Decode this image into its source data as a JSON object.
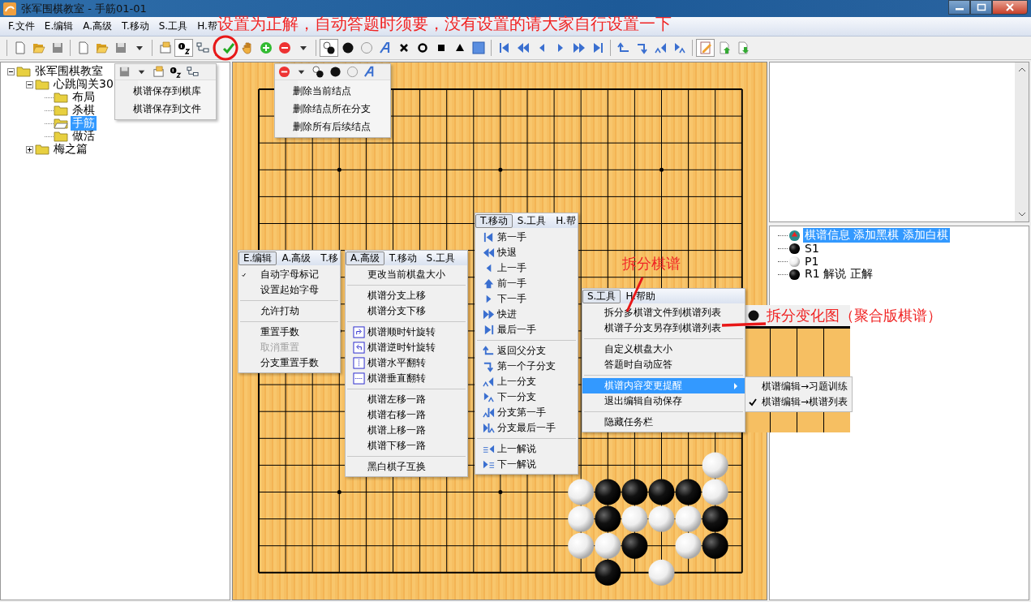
{
  "window": {
    "title": "张军围棋教室 - 手筋01-01"
  },
  "menu_bar": [
    "F.文件",
    "E.编辑",
    "A.高级",
    "T.移动",
    "S.工具",
    "H.帮"
  ],
  "toolbar_toggles": [
    {
      "pressed": true
    },
    {
      "pressed": true
    },
    {
      "pressed": true
    }
  ],
  "file_tree": [
    {
      "label": "张军围棋教室",
      "expanded": true,
      "selected": false,
      "children": [
        {
          "label": "心跳闯关30",
          "expanded": true,
          "selected": false,
          "children": [
            {
              "label": "布局",
              "selected": false
            },
            {
              "label": "杀棋",
              "selected": false
            },
            {
              "label": "手筋",
              "selected": true
            },
            {
              "label": "做活",
              "selected": false
            }
          ]
        },
        {
          "label": "梅之篇",
          "expanded": false,
          "selected": false
        }
      ]
    }
  ],
  "board": {
    "rows": [
      {
        "cells": [
          {
            "kind": "empty"
          },
          {
            "kind": "empty"
          },
          {
            "kind": "empty"
          },
          {
            "kind": "empty"
          },
          {
            "kind": "empty"
          },
          {
            "kind": "empty"
          },
          {
            "kind": "empty"
          },
          {
            "kind": "empty"
          },
          {
            "kind": "empty"
          },
          {
            "kind": "empty"
          },
          {
            "kind": "empty"
          },
          {
            "kind": "empty"
          },
          {
            "kind": "empty"
          },
          {
            "kind": "empty"
          },
          {
            "kind": "empty"
          },
          {
            "kind": "empty"
          },
          {
            "kind": "empty"
          },
          {
            "kind": "empty"
          },
          {
            "kind": "empty"
          }
        ]
      },
      {
        "cells": [
          {
            "kind": "empty"
          },
          {
            "kind": "empty"
          },
          {
            "kind": "empty"
          },
          {
            "kind": "empty"
          },
          {
            "kind": "empty"
          },
          {
            "kind": "empty"
          },
          {
            "kind": "empty"
          },
          {
            "kind": "empty"
          },
          {
            "kind": "empty"
          },
          {
            "kind": "empty"
          },
          {
            "kind": "empty"
          },
          {
            "kind": "empty"
          },
          {
            "kind": "empty"
          },
          {
            "kind": "empty"
          },
          {
            "kind": "empty"
          },
          {
            "kind": "empty"
          },
          {
            "kind": "empty"
          },
          {
            "kind": "empty"
          },
          {
            "kind": "empty"
          }
        ]
      },
      {
        "cells": [
          {
            "kind": "empty"
          },
          {
            "kind": "empty"
          },
          {
            "kind": "empty"
          },
          {
            "kind": "empty"
          },
          {
            "kind": "empty"
          },
          {
            "kind": "empty"
          },
          {
            "kind": "empty"
          },
          {
            "kind": "empty"
          },
          {
            "kind": "empty"
          },
          {
            "kind": "empty"
          },
          {
            "kind": "empty"
          },
          {
            "kind": "empty"
          },
          {
            "kind": "empty"
          },
          {
            "kind": "empty"
          },
          {
            "kind": "empty"
          },
          {
            "kind": "empty"
          },
          {
            "kind": "empty"
          },
          {
            "kind": "empty"
          },
          {
            "kind": "empty"
          }
        ]
      },
      {
        "cells": [
          {
            "kind": "empty"
          },
          {
            "kind": "empty"
          },
          {
            "kind": "empty"
          },
          {
            "kind": "empty"
          },
          {
            "kind": "empty"
          },
          {
            "kind": "empty"
          },
          {
            "kind": "empty"
          },
          {
            "kind": "empty"
          },
          {
            "kind": "empty"
          },
          {
            "kind": "empty"
          },
          {
            "kind": "empty"
          },
          {
            "kind": "empty"
          },
          {
            "kind": "empty"
          },
          {
            "kind": "empty"
          },
          {
            "kind": "empty"
          },
          {
            "kind": "empty"
          },
          {
            "kind": "empty"
          },
          {
            "kind": "empty"
          },
          {
            "kind": "empty"
          }
        ]
      },
      {
        "cells": [
          {
            "kind": "empty"
          },
          {
            "kind": "empty"
          },
          {
            "kind": "empty"
          },
          {
            "kind": "empty"
          },
          {
            "kind": "empty"
          },
          {
            "kind": "empty"
          },
          {
            "kind": "empty"
          },
          {
            "kind": "empty"
          },
          {
            "kind": "empty"
          },
          {
            "kind": "empty"
          },
          {
            "kind": "empty"
          },
          {
            "kind": "empty"
          },
          {
            "kind": "empty"
          },
          {
            "kind": "empty"
          },
          {
            "kind": "empty"
          },
          {
            "kind": "empty"
          },
          {
            "kind": "empty"
          },
          {
            "kind": "empty"
          },
          {
            "kind": "empty"
          }
        ]
      },
      {
        "cells": [
          {
            "kind": "empty"
          },
          {
            "kind": "empty"
          },
          {
            "kind": "empty"
          },
          {
            "kind": "empty"
          },
          {
            "kind": "empty"
          },
          {
            "kind": "empty"
          },
          {
            "kind": "empty"
          },
          {
            "kind": "empty"
          },
          {
            "kind": "empty"
          },
          {
            "kind": "empty"
          },
          {
            "kind": "empty"
          },
          {
            "kind": "empty"
          },
          {
            "kind": "empty"
          },
          {
            "kind": "empty"
          },
          {
            "kind": "empty"
          },
          {
            "kind": "empty"
          },
          {
            "kind": "empty"
          },
          {
            "kind": "empty"
          },
          {
            "kind": "empty"
          }
        ]
      },
      {
        "cells": [
          {
            "kind": "empty"
          },
          {
            "kind": "empty"
          },
          {
            "kind": "empty"
          },
          {
            "kind": "empty"
          },
          {
            "kind": "empty"
          },
          {
            "kind": "empty"
          },
          {
            "kind": "empty"
          },
          {
            "kind": "empty"
          },
          {
            "kind": "empty"
          },
          {
            "kind": "empty"
          },
          {
            "kind": "empty"
          },
          {
            "kind": "empty"
          },
          {
            "kind": "empty"
          },
          {
            "kind": "empty"
          },
          {
            "kind": "empty"
          },
          {
            "kind": "empty"
          },
          {
            "kind": "empty"
          },
          {
            "kind": "empty"
          },
          {
            "kind": "empty"
          }
        ]
      },
      {
        "cells": [
          {
            "kind": "empty"
          },
          {
            "kind": "empty"
          },
          {
            "kind": "empty"
          },
          {
            "kind": "empty"
          },
          {
            "kind": "empty"
          },
          {
            "kind": "empty"
          },
          {
            "kind": "empty"
          },
          {
            "kind": "empty"
          },
          {
            "kind": "empty"
          },
          {
            "kind": "empty"
          },
          {
            "kind": "empty"
          },
          {
            "kind": "empty"
          },
          {
            "kind": "empty"
          },
          {
            "kind": "empty"
          },
          {
            "kind": "empty"
          },
          {
            "kind": "empty"
          },
          {
            "kind": "empty"
          },
          {
            "kind": "empty"
          },
          {
            "kind": "empty"
          }
        ]
      },
      {
        "cells": [
          {
            "kind": "empty"
          },
          {
            "kind": "empty"
          },
          {
            "kind": "empty"
          },
          {
            "kind": "empty"
          },
          {
            "kind": "empty"
          },
          {
            "kind": "empty"
          },
          {
            "kind": "empty"
          },
          {
            "kind": "empty"
          },
          {
            "kind": "empty"
          },
          {
            "kind": "empty"
          },
          {
            "kind": "empty"
          },
          {
            "kind": "empty"
          },
          {
            "kind": "empty"
          },
          {
            "kind": "empty"
          },
          {
            "kind": "empty"
          },
          {
            "kind": "empty"
          },
          {
            "kind": "empty"
          },
          {
            "kind": "empty"
          },
          {
            "kind": "empty"
          }
        ]
      },
      {
        "cells": [
          {
            "kind": "empty"
          },
          {
            "kind": "empty"
          },
          {
            "kind": "empty"
          },
          {
            "kind": "empty"
          },
          {
            "kind": "empty"
          },
          {
            "kind": "empty"
          },
          {
            "kind": "empty"
          },
          {
            "kind": "empty"
          },
          {
            "kind": "empty"
          },
          {
            "kind": "empty"
          },
          {
            "kind": "empty"
          },
          {
            "kind": "empty"
          },
          {
            "kind": "empty"
          },
          {
            "kind": "empty"
          },
          {
            "kind": "empty"
          },
          {
            "kind": "empty"
          },
          {
            "kind": "empty"
          },
          {
            "kind": "empty"
          },
          {
            "kind": "empty"
          }
        ]
      },
      {
        "cells": [
          {
            "kind": "empty"
          },
          {
            "kind": "empty"
          },
          {
            "kind": "empty"
          },
          {
            "kind": "empty"
          },
          {
            "kind": "empty"
          },
          {
            "kind": "empty"
          },
          {
            "kind": "empty"
          },
          {
            "kind": "empty"
          },
          {
            "kind": "empty"
          },
          {
            "kind": "empty"
          },
          {
            "kind": "empty"
          },
          {
            "kind": "empty"
          },
          {
            "kind": "empty"
          },
          {
            "kind": "empty"
          },
          {
            "kind": "empty"
          },
          {
            "kind": "empty"
          },
          {
            "kind": "empty"
          },
          {
            "kind": "empty"
          },
          {
            "kind": "empty"
          }
        ]
      },
      {
        "cells": [
          {
            "kind": "empty"
          },
          {
            "kind": "empty"
          },
          {
            "kind": "empty"
          },
          {
            "kind": "empty"
          },
          {
            "kind": "empty"
          },
          {
            "kind": "empty"
          },
          {
            "kind": "empty"
          },
          {
            "kind": "empty"
          },
          {
            "kind": "empty"
          },
          {
            "kind": "empty"
          },
          {
            "kind": "empty"
          },
          {
            "kind": "empty"
          },
          {
            "kind": "empty"
          },
          {
            "kind": "empty"
          },
          {
            "kind": "empty"
          },
          {
            "kind": "empty"
          },
          {
            "kind": "empty"
          },
          {
            "kind": "empty"
          },
          {
            "kind": "empty"
          }
        ]
      },
      {
        "cells": [
          {
            "kind": "empty"
          },
          {
            "kind": "empty"
          },
          {
            "kind": "empty"
          },
          {
            "kind": "empty"
          },
          {
            "kind": "empty"
          },
          {
            "kind": "empty"
          },
          {
            "kind": "empty"
          },
          {
            "kind": "empty"
          },
          {
            "kind": "empty"
          },
          {
            "kind": "empty"
          },
          {
            "kind": "empty"
          },
          {
            "kind": "empty"
          },
          {
            "kind": "empty"
          },
          {
            "kind": "empty"
          },
          {
            "kind": "empty"
          },
          {
            "kind": "empty"
          },
          {
            "kind": "empty"
          },
          {
            "kind": "empty"
          },
          {
            "kind": "empty"
          }
        ]
      },
      {
        "cells": [
          {
            "kind": "empty"
          },
          {
            "kind": "empty"
          },
          {
            "kind": "empty"
          },
          {
            "kind": "empty"
          },
          {
            "kind": "empty"
          },
          {
            "kind": "empty"
          },
          {
            "kind": "empty"
          },
          {
            "kind": "empty"
          },
          {
            "kind": "empty"
          },
          {
            "kind": "empty"
          },
          {
            "kind": "empty"
          },
          {
            "kind": "empty"
          },
          {
            "kind": "empty"
          },
          {
            "kind": "empty"
          },
          {
            "kind": "empty"
          },
          {
            "kind": "empty"
          },
          {
            "kind": "empty"
          },
          {
            "kind": "empty"
          },
          {
            "kind": "empty"
          }
        ]
      },
      {
        "cells": [
          {
            "kind": "empty"
          },
          {
            "kind": "empty"
          },
          {
            "kind": "empty"
          },
          {
            "kind": "empty"
          },
          {
            "kind": "empty"
          },
          {
            "kind": "empty"
          },
          {
            "kind": "empty"
          },
          {
            "kind": "empty"
          },
          {
            "kind": "empty"
          },
          {
            "kind": "empty"
          },
          {
            "kind": "empty"
          },
          {
            "kind": "empty"
          },
          {
            "kind": "empty"
          },
          {
            "kind": "empty"
          },
          {
            "kind": "empty"
          },
          {
            "kind": "empty"
          },
          {
            "kind": "empty"
          },
          {
            "kind": "white"
          },
          {
            "kind": "empty"
          }
        ]
      },
      {
        "cells": [
          {
            "kind": "empty"
          },
          {
            "kind": "empty"
          },
          {
            "kind": "empty"
          },
          {
            "kind": "empty"
          },
          {
            "kind": "empty"
          },
          {
            "kind": "empty"
          },
          {
            "kind": "empty"
          },
          {
            "kind": "empty"
          },
          {
            "kind": "empty"
          },
          {
            "kind": "empty"
          },
          {
            "kind": "empty"
          },
          {
            "kind": "empty"
          },
          {
            "kind": "white"
          },
          {
            "kind": "black"
          },
          {
            "kind": "black"
          },
          {
            "kind": "black"
          },
          {
            "kind": "black"
          },
          {
            "kind": "white"
          },
          {
            "kind": "empty"
          }
        ]
      },
      {
        "cells": [
          {
            "kind": "empty"
          },
          {
            "kind": "empty"
          },
          {
            "kind": "empty"
          },
          {
            "kind": "empty"
          },
          {
            "kind": "empty"
          },
          {
            "kind": "empty"
          },
          {
            "kind": "empty"
          },
          {
            "kind": "empty"
          },
          {
            "kind": "empty"
          },
          {
            "kind": "empty"
          },
          {
            "kind": "empty"
          },
          {
            "kind": "empty"
          },
          {
            "kind": "white"
          },
          {
            "kind": "black"
          },
          {
            "kind": "white"
          },
          {
            "kind": "white"
          },
          {
            "kind": "white"
          },
          {
            "kind": "black"
          },
          {
            "kind": "empty"
          }
        ]
      },
      {
        "cells": [
          {
            "kind": "empty"
          },
          {
            "kind": "empty"
          },
          {
            "kind": "empty"
          },
          {
            "kind": "empty"
          },
          {
            "kind": "empty"
          },
          {
            "kind": "empty"
          },
          {
            "kind": "empty"
          },
          {
            "kind": "empty"
          },
          {
            "kind": "empty"
          },
          {
            "kind": "empty"
          },
          {
            "kind": "empty"
          },
          {
            "kind": "empty"
          },
          {
            "kind": "white"
          },
          {
            "kind": "white"
          },
          {
            "kind": "black"
          },
          {
            "kind": "empty"
          },
          {
            "kind": "white"
          },
          {
            "kind": "black"
          },
          {
            "kind": "empty"
          }
        ]
      },
      {
        "cells": [
          {
            "kind": "empty"
          },
          {
            "kind": "empty"
          },
          {
            "kind": "empty"
          },
          {
            "kind": "empty"
          },
          {
            "kind": "empty"
          },
          {
            "kind": "empty"
          },
          {
            "kind": "empty"
          },
          {
            "kind": "empty"
          },
          {
            "kind": "empty"
          },
          {
            "kind": "empty"
          },
          {
            "kind": "empty"
          },
          {
            "kind": "empty"
          },
          {
            "kind": "empty"
          },
          {
            "kind": "black"
          },
          {
            "kind": "empty"
          },
          {
            "kind": "white"
          },
          {
            "kind": "empty"
          },
          {
            "kind": "empty"
          },
          {
            "kind": "empty"
          }
        ]
      }
    ]
  },
  "move_tree": [
    {
      "kind": "info",
      "label": "棋谱信息 添加黑棋 添加白棋",
      "selected": true
    },
    {
      "kind": "black",
      "label": "S1",
      "selected": false
    },
    {
      "kind": "white",
      "label": "P1",
      "selected": false
    },
    {
      "kind": "black",
      "label": "R1 解说 正解",
      "selected": false
    }
  ],
  "popups": [
    {
      "kind": "toolbar_menu",
      "groups": [
        [
          {
            "label": "棋谱保存到棋库",
            "checked": false,
            "disabled": false,
            "selected": false
          },
          {
            "label": "棋谱保存到文件",
            "checked": false,
            "disabled": false,
            "selected": false
          }
        ]
      ]
    },
    {
      "kind": "toolbar_menu",
      "groups": [
        [
          {
            "label": "删除当前结点",
            "checked": false,
            "disabled": false,
            "selected": false
          },
          {
            "label": "删除结点所在分支",
            "checked": false,
            "disabled": false,
            "selected": false
          },
          {
            "label": "删除所有后续结点",
            "checked": false,
            "disabled": false,
            "selected": false
          }
        ]
      ]
    },
    {
      "kind": "menu",
      "bar": [
        {
          "label": "E.编辑",
          "selected": true
        },
        {
          "label": "A.高级",
          "selected": false
        },
        {
          "label": "T.移",
          "selected": false
        }
      ],
      "groups": [
        [
          {
            "label": "自动字母标记",
            "checked": true,
            "disabled": false,
            "selected": false
          },
          {
            "label": "设置起始字母",
            "checked": false,
            "disabled": false,
            "selected": false
          }
        ],
        [
          {
            "label": "允许打劫",
            "checked": false,
            "disabled": false,
            "selected": false
          }
        ],
        [
          {
            "label": "重置手数",
            "checked": false,
            "disabled": false,
            "selected": false
          },
          {
            "label": "取消重置",
            "checked": false,
            "disabled": true,
            "selected": false
          },
          {
            "label": "分支重置手数",
            "checked": false,
            "disabled": false,
            "selected": false
          }
        ]
      ]
    },
    {
      "kind": "menu",
      "bar": [
        {
          "label": "A.高级",
          "selected": true
        },
        {
          "label": "T.移动",
          "selected": false
        },
        {
          "label": "S.工具",
          "selected": false
        }
      ],
      "groups": [
        [
          {
            "label": "更改当前棋盘大小",
            "checked": false,
            "disabled": false,
            "selected": false
          }
        ],
        [
          {
            "label": "棋谱分支上移",
            "checked": false,
            "disabled": false,
            "selected": false
          },
          {
            "label": "棋谱分支下移",
            "checked": false,
            "disabled": false,
            "selected": false
          }
        ],
        [
          {
            "label": "棋谱顺时针旋转",
            "checked": false,
            "disabled": false,
            "selected": false
          },
          {
            "label": "棋谱逆时针旋转",
            "checked": false,
            "disabled": false,
            "selected": false
          },
          {
            "label": "棋谱水平翻转",
            "checked": false,
            "disabled": false,
            "selected": false
          },
          {
            "label": "棋谱垂直翻转",
            "checked": false,
            "disabled": false,
            "selected": false
          }
        ],
        [
          {
            "label": "棋谱左移一路",
            "checked": false,
            "disabled": false,
            "selected": false
          },
          {
            "label": "棋谱右移一路",
            "checked": false,
            "disabled": false,
            "selected": false
          },
          {
            "label": "棋谱上移一路",
            "checked": false,
            "disabled": false,
            "selected": false
          },
          {
            "label": "棋谱下移一路",
            "checked": false,
            "disabled": false,
            "selected": false
          }
        ],
        [
          {
            "label": "黑白棋子互换",
            "checked": false,
            "disabled": false,
            "selected": false
          }
        ]
      ]
    },
    {
      "kind": "menu",
      "bar": [
        {
          "label": "T.移动",
          "selected": true
        },
        {
          "label": "S.工具",
          "selected": false
        },
        {
          "label": "H.帮",
          "selected": false
        }
      ],
      "groups": [
        [
          {
            "label": "第一手",
            "checked": false,
            "disabled": false,
            "selected": false
          },
          {
            "label": "快退",
            "checked": false,
            "disabled": false,
            "selected": false
          },
          {
            "label": "上一手",
            "checked": false,
            "disabled": false,
            "selected": false
          },
          {
            "label": "前一手",
            "checked": false,
            "disabled": false,
            "selected": false
          },
          {
            "label": "下一手",
            "checked": false,
            "disabled": false,
            "selected": false
          },
          {
            "label": "快进",
            "checked": false,
            "disabled": false,
            "selected": false
          },
          {
            "label": "最后一手",
            "checked": false,
            "disabled": false,
            "selected": false
          }
        ],
        [
          {
            "label": "返回父分支",
            "checked": false,
            "disabled": false,
            "selected": false
          },
          {
            "label": "第一个子分支",
            "checked": false,
            "disabled": false,
            "selected": false
          },
          {
            "label": "上一分支",
            "checked": false,
            "disabled": false,
            "selected": false
          },
          {
            "label": "下一分支",
            "checked": false,
            "disabled": false,
            "selected": false
          },
          {
            "label": "分支第一手",
            "checked": false,
            "disabled": false,
            "selected": false
          },
          {
            "label": "分支最后一手",
            "checked": false,
            "disabled": false,
            "selected": false
          }
        ],
        [
          {
            "label": "上一解说",
            "checked": false,
            "disabled": false,
            "selected": false
          },
          {
            "label": "下一解说",
            "checked": false,
            "disabled": false,
            "selected": false
          }
        ]
      ]
    },
    {
      "kind": "menu",
      "bar": [
        {
          "label": "S.工具",
          "selected": true
        },
        {
          "label": "H.帮助",
          "selected": false
        }
      ],
      "groups": [
        [
          {
            "label": "拆分多棋谱文件到棋谱列表",
            "checked": false,
            "disabled": false,
            "selected": false
          },
          {
            "label": "棋谱子分支另存到棋谱列表",
            "checked": false,
            "disabled": false,
            "selected": false
          }
        ],
        [
          {
            "label": "自定义棋盘大小",
            "checked": false,
            "disabled": false,
            "selected": false
          },
          {
            "label": "答题时自动应答",
            "checked": false,
            "disabled": false,
            "selected": false
          }
        ],
        [
          {
            "label": "棋谱内容变更提醒",
            "checked": false,
            "disabled": false,
            "selected": true,
            "submenu": [
              {
                "label": "棋谱编辑→习题训练",
                "checked": false,
                "disabled": false,
                "selected": false
              },
              {
                "label": "棋谱编辑→棋谱列表",
                "checked": true,
                "disabled": false,
                "selected": false
              }
            ]
          },
          {
            "label": "退出编辑自动保存",
            "checked": false,
            "disabled": false,
            "selected": false
          }
        ],
        [
          {
            "label": "隐藏任务栏",
            "checked": false,
            "disabled": false,
            "selected": false
          }
        ]
      ]
    }
  ],
  "annotations": [
    {
      "text": "设置为正解，自动答题时须要，没有设置的请大家自行设置一下"
    },
    {
      "text": "拆分棋谱"
    },
    {
      "text": "拆分变化图（聚合版棋谱）"
    }
  ]
}
